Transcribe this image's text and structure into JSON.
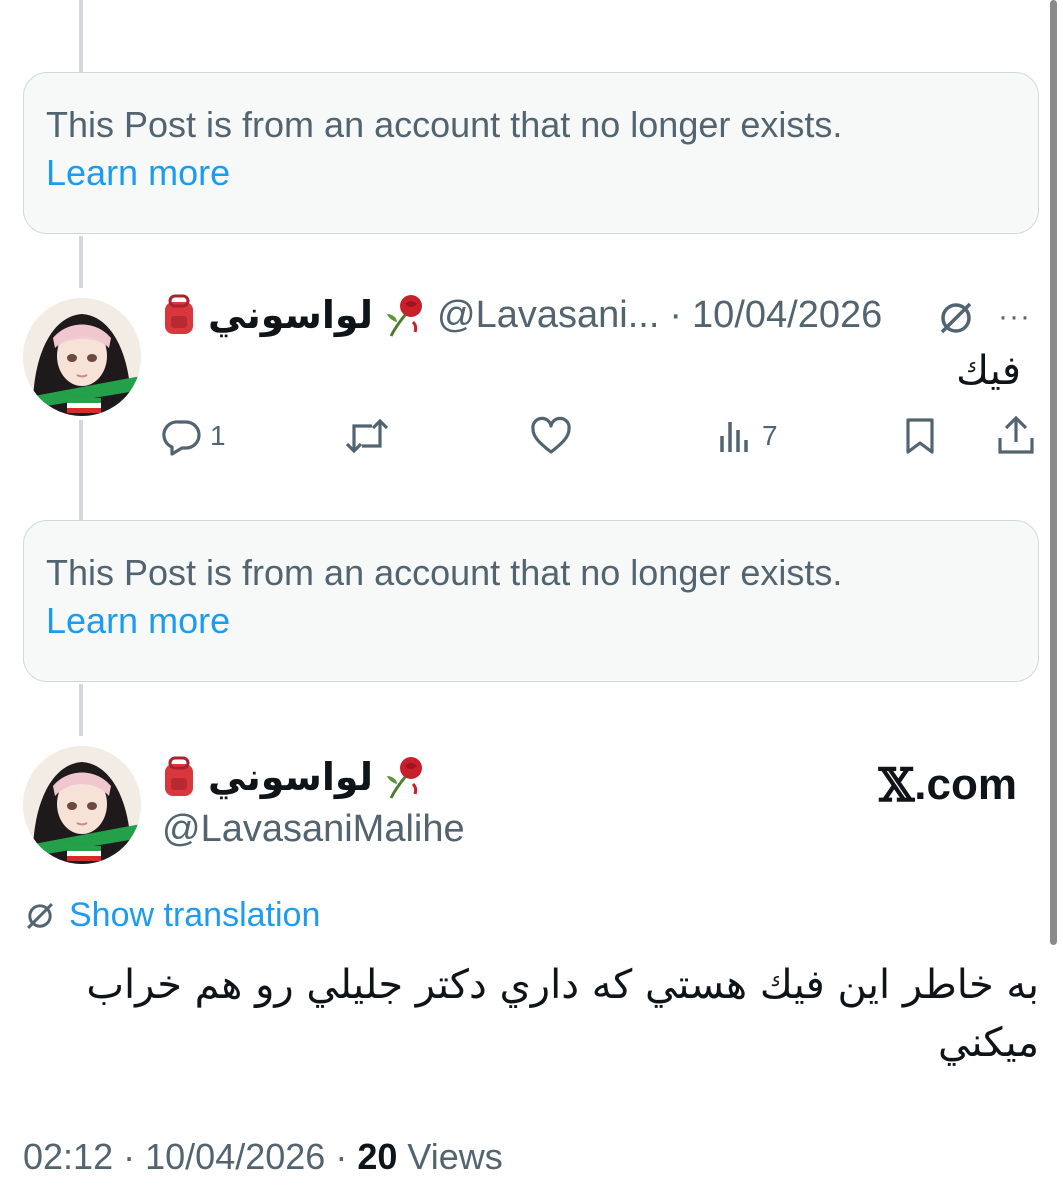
{
  "notice_1": {
    "text": "This Post is from an account that no longer exists.",
    "link": "Learn more"
  },
  "reply": {
    "display_name": "لواسوني",
    "handle": "@Lavasani...",
    "separator": "·",
    "date": "10/04/2026",
    "text": "فيك",
    "actions": {
      "replies": "1",
      "reposts": "",
      "likes": "",
      "views": "7"
    },
    "more_label": "···"
  },
  "notice_2": {
    "text": "This Post is from an account that no longer exists.",
    "link": "Learn more"
  },
  "main_post": {
    "display_name": "لواسوني",
    "handle": "@LavasaniMalihe",
    "brand": ".com",
    "show_translation": "Show translation",
    "text_line1": "به خاطر اين فيك هستي كه داري دكتر جليلي رو هم خراب",
    "text_line2": "ميكني",
    "time": "02:12",
    "date": "10/04/2026",
    "separator": "·",
    "views_count": "20",
    "views_label": "Views"
  },
  "colors": {
    "accent": "#1d9bf0",
    "secondary_text": "#536471",
    "border": "#cfd9de"
  },
  "icons": [
    "reply-icon",
    "repost-icon",
    "like-icon",
    "views-icon",
    "bookmark-icon",
    "share-icon",
    "grok-icon",
    "more-icon",
    "rose-emoji-icon",
    "backpack-emoji-icon",
    "x-logo-icon",
    "translate-icon"
  ]
}
